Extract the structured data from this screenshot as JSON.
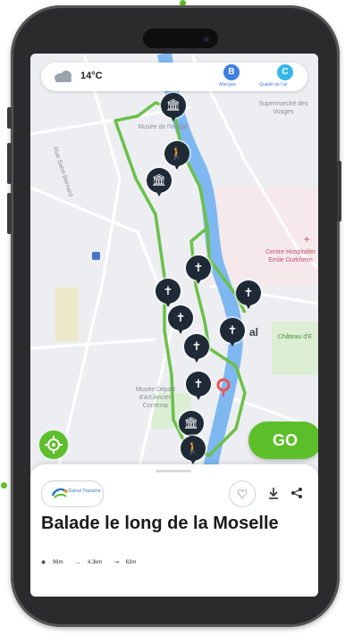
{
  "weather": {
    "icon": "cloud-icon",
    "temperature": "14°C",
    "badges": [
      {
        "letter": "B",
        "label": "Allergies",
        "color": "#3f7fe0"
      },
      {
        "letter": "C",
        "label": "Qualité de l'air",
        "color": "#35b6e8"
      }
    ]
  },
  "map": {
    "labels": {
      "street": "Rue Saint-Bernard",
      "museum_image": "Musée de l'Image",
      "supermarket": "Supermarché des Vosges",
      "hospital": "Centre Hospitalier Emile Durkheim",
      "chateau": "Château d'E",
      "museum_art": "Musée Départ d'Art Ancien Contemp",
      "town": "al"
    },
    "route_color": "#6cc04a",
    "river_color": "#7fb8f0"
  },
  "buttons": {
    "go": "GO",
    "locate_icon": "locate-icon"
  },
  "card": {
    "logo_text": "Épinal Tourisme",
    "title": "Balade le long de la Moselle",
    "stats": {
      "elevation_max": "96m",
      "distance": "4.3km",
      "elevation_gain": "63m"
    }
  }
}
